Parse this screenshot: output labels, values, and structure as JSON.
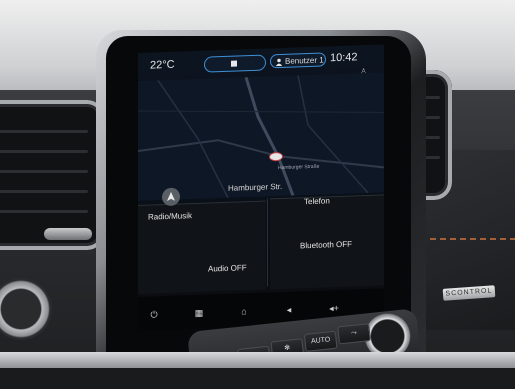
{
  "status_bar": {
    "temperature": "22°C",
    "user_label": "Benutzer 1",
    "time": "10:42"
  },
  "map": {
    "street_label": "Hamburger Str.",
    "street_small_label": "Hamburger Straße"
  },
  "tiles": {
    "radio": "Radio/Musik",
    "phone": "Telefon",
    "audio_status": "Audio OFF",
    "bluetooth_status": "Bluetooth OFF"
  },
  "dock": {
    "power_icon": "power-icon",
    "apps_icon": "apps-grid-icon",
    "home_icon": "home-icon",
    "volume_down_icon": "volume-down-icon",
    "volume_up_icon": "volume-up-icon"
  },
  "climate": {
    "auto_label": "AUTO"
  },
  "badge": {
    "text": "SCONTROL"
  },
  "colors": {
    "accent": "#3e8fd6",
    "hazard": "#d43a2f"
  }
}
